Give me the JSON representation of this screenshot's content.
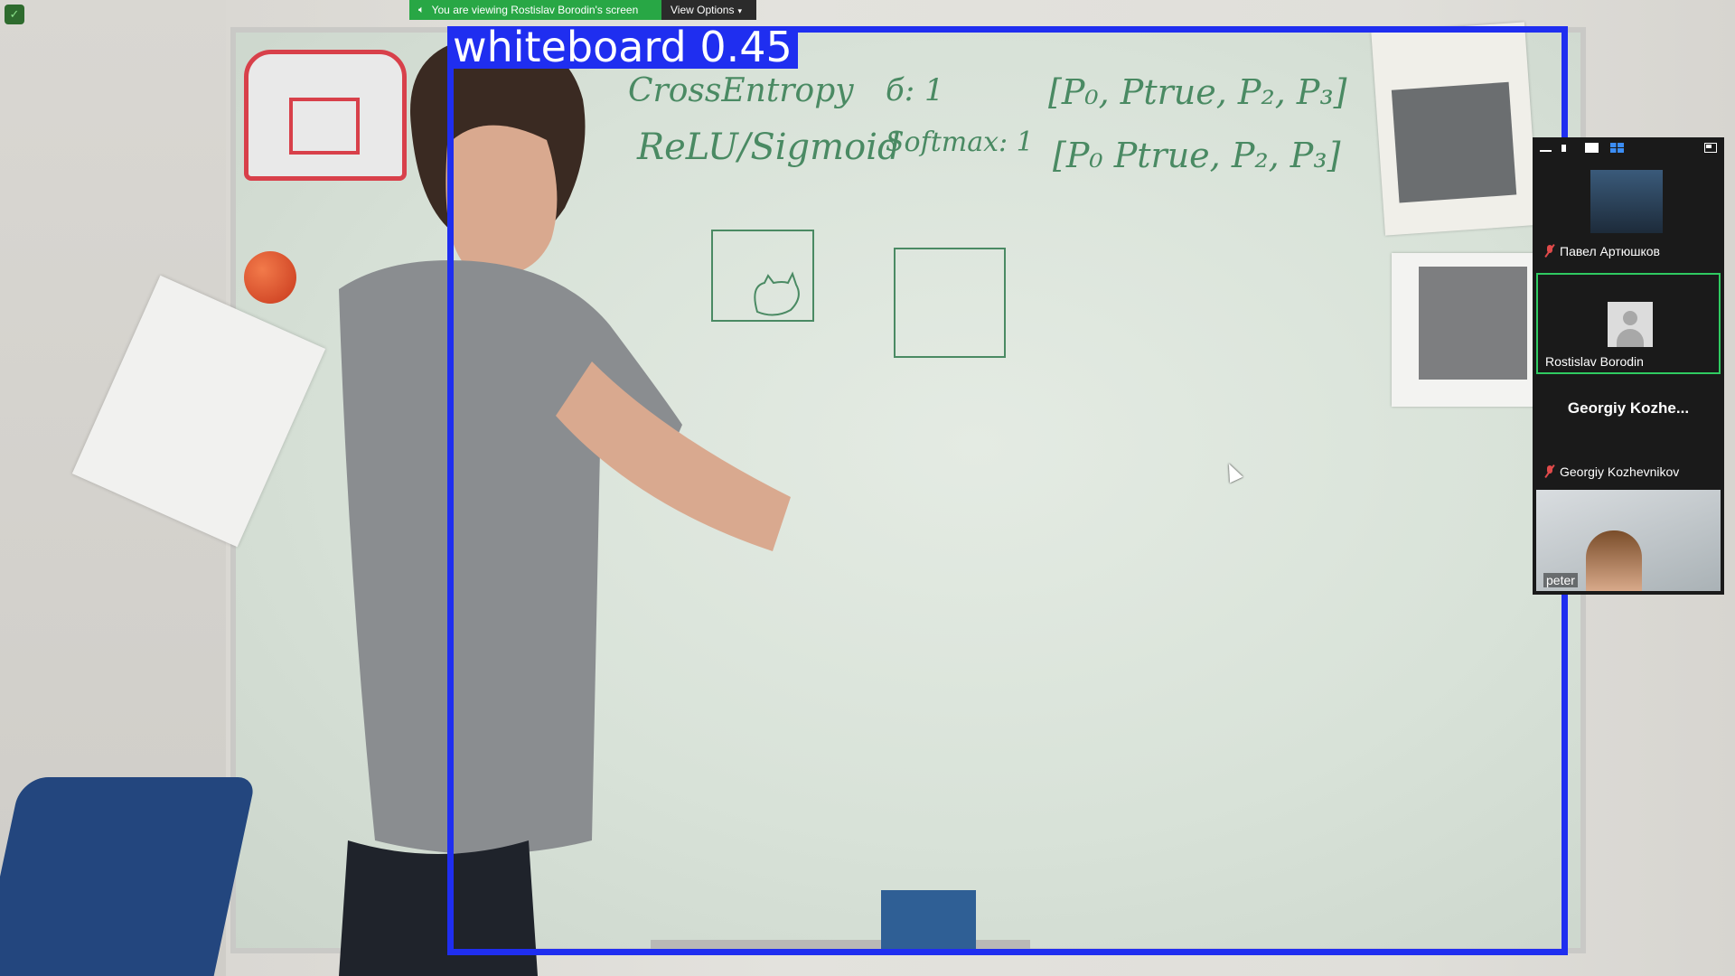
{
  "detection": {
    "label": "whiteboard  0.45",
    "color": "#1f2ef0"
  },
  "zoom": {
    "banner_text": "You are viewing Rostislav Borodin's screen",
    "view_options_label": "View Options",
    "banner_color": "#28a745"
  },
  "whiteboard_writing": {
    "line1_left": "CrossEntropy",
    "line1_mid": "б:   1",
    "line1_right": "[P₀, Ptrue, P₂, P₃]",
    "line2_left": "ReLU/Sigmoid",
    "line2_mid": "Softmax:   1",
    "line2_right": "[P₀  Ptrue, P₂, P₃]"
  },
  "gallery": {
    "toolbar_icons": [
      "minimize-icon",
      "speaker-view-icon",
      "single-view-icon",
      "gallery-view-icon",
      "exit-fullscreen-icon"
    ],
    "participants": [
      {
        "name": "Павел Артюшков",
        "muted": true,
        "display": "photo"
      },
      {
        "name": "Rostislav Borodin",
        "muted": false,
        "display": "avatar",
        "active": true
      },
      {
        "name": "Georgiy Kozhevnikov",
        "display_name": "Georgiy Kozhe...",
        "muted": true,
        "display": "name"
      },
      {
        "name": "peter",
        "muted": false,
        "display": "video"
      }
    ],
    "active_border_color": "#2fca61"
  }
}
